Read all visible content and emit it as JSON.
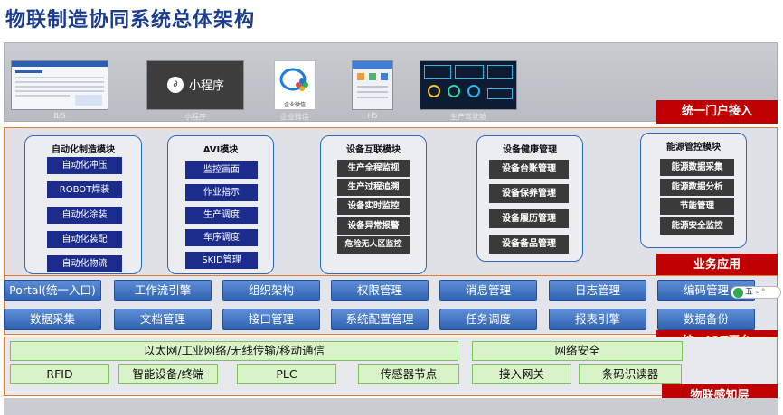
{
  "title": "物联制造协同系统总体架构",
  "portal": {
    "tag": "统一门户接入",
    "items": [
      {
        "label": "B/S",
        "icon": "web-dashboard-thumbnail"
      },
      {
        "label": "小程序",
        "icon": "mini-program-thumbnail",
        "inner": "小程序"
      },
      {
        "label": "企业微信",
        "icon": "wecom-icon",
        "inner": "企业微信"
      },
      {
        "label": "H5",
        "icon": "h5-page-thumbnail"
      },
      {
        "label": "生产驾驶舱",
        "icon": "cockpit-dashboard-thumbnail"
      }
    ]
  },
  "business": {
    "tag": "业务应用",
    "modules": [
      {
        "title": "自动化制造模块",
        "items": [
          "自动化冲压",
          "ROBOT焊装",
          "自动化涂装",
          "自动化装配",
          "自动化物流"
        ]
      },
      {
        "title": "AVI模块",
        "items": [
          "监控画面",
          "作业指示",
          "生产调度",
          "车序调度",
          "SKID管理"
        ]
      },
      {
        "title": "设备互联模块",
        "items": [
          "生产全程监视",
          "生产过程追溯",
          "设备实时监控",
          "设备异常报警",
          "危险无人区监控"
        ]
      },
      {
        "title": "设备健康管理",
        "items": [
          "设备台账管理",
          "设备保养管理",
          "设备履历管理",
          "设备备品管理"
        ]
      },
      {
        "title": "能源管控模块",
        "items": [
          "能源数据采集",
          "能源数据分析",
          "节能管理",
          "能源安全监控"
        ]
      }
    ]
  },
  "platform": {
    "tag": "统一IOT平台",
    "row1": [
      "Portal(统一入口)",
      "工作流引擎",
      "组织架构",
      "权限管理",
      "消息管理",
      "日志管理",
      "编码管理"
    ],
    "row2": [
      "数据采集",
      "文档管理",
      "接口管理",
      "系统配置管理",
      "任务调度",
      "报表引擎",
      "数据备份"
    ]
  },
  "perception": {
    "tag": "物联感知层",
    "network": "以太网/工业网络/无线传输/移动通信",
    "security": "网络安全",
    "devices": [
      "RFID",
      "智能设备/终端",
      "PLC",
      "传感器节点",
      "接入网关",
      "条码识读器"
    ]
  },
  "colors": {
    "title": "#1a3c8c",
    "tag": "#c00000",
    "module_item": "#1c2c8c",
    "platform_btn": "#3a6fc0",
    "perception_box": "#d9f3c8",
    "band_border": "#e07b34"
  },
  "ime_badge": "五"
}
